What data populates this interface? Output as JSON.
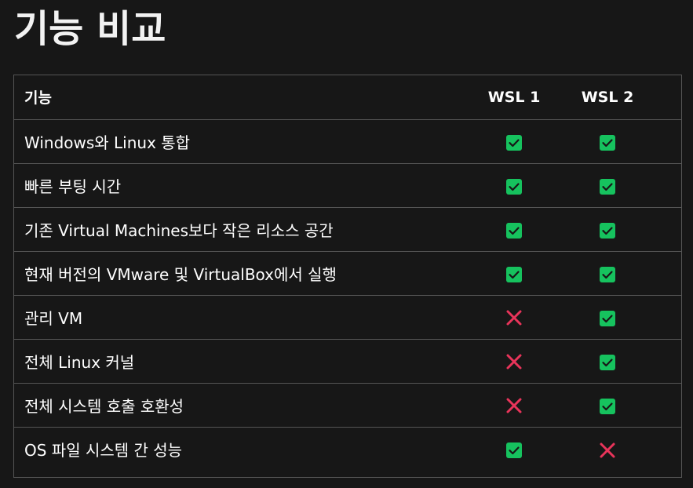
{
  "title": "기능 비교",
  "table": {
    "headers": [
      "기능",
      "WSL 1",
      "WSL 2"
    ],
    "rows": [
      {
        "feature": "Windows와 Linux 통합",
        "wsl1": "check",
        "wsl2": "check"
      },
      {
        "feature": "빠른 부팅 시간",
        "wsl1": "check",
        "wsl2": "check"
      },
      {
        "feature": "기존 Virtual Machines보다 작은 리소스 공간",
        "wsl1": "check",
        "wsl2": "check"
      },
      {
        "feature": "현재 버전의 VMware 및 VirtualBox에서 실행",
        "wsl1": "check",
        "wsl2": "check"
      },
      {
        "feature": "관리 VM",
        "wsl1": "cross",
        "wsl2": "check"
      },
      {
        "feature": "전체 Linux 커널",
        "wsl1": "cross",
        "wsl2": "check"
      },
      {
        "feature": "전체 시스템 호출 호환성",
        "wsl1": "cross",
        "wsl2": "check"
      },
      {
        "feature": "OS 파일 시스템 간 성능",
        "wsl1": "check",
        "wsl2": "cross"
      }
    ]
  },
  "colors": {
    "check": "#16c25e",
    "cross": "#e8345a"
  },
  "icons": {
    "check": "check-mark-icon",
    "cross": "cross-mark-icon"
  }
}
